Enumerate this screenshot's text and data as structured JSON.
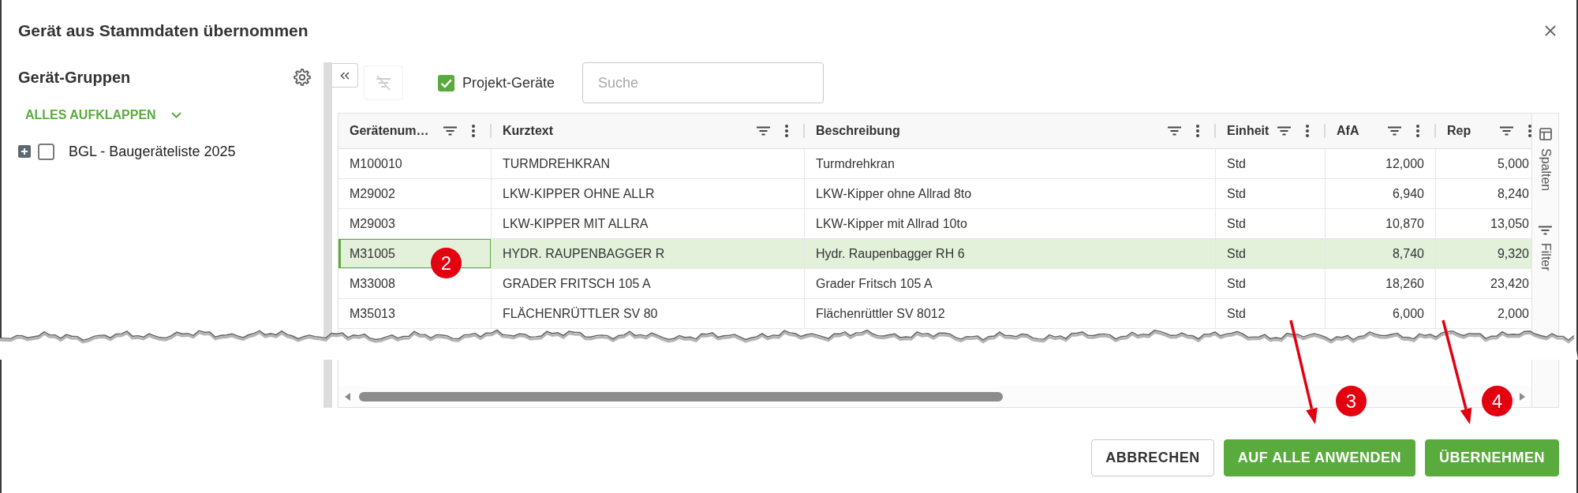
{
  "dialog": {
    "title": "Gerät aus Stammdaten übernommen"
  },
  "sidebar": {
    "title": "Gerät-Gruppen",
    "expand_all": "ALLES AUFKLAPPEN",
    "tree": [
      {
        "label": "BGL - Baugeräteliste 2025",
        "expanded": false,
        "checked": false
      }
    ]
  },
  "toolbar": {
    "clear_filter": {
      "disabled": true
    },
    "project_filter": {
      "label": "Projekt-Geräte",
      "checked": true
    },
    "search": {
      "placeholder": "Suche"
    }
  },
  "table": {
    "columns": [
      {
        "label": "Gerätenum…",
        "kind": "text"
      },
      {
        "label": "Kurztext",
        "kind": "text"
      },
      {
        "label": "Beschreibung",
        "kind": "text"
      },
      {
        "label": "Einheit",
        "kind": "text"
      },
      {
        "label": "AfA",
        "kind": "number"
      },
      {
        "label": "Rep",
        "kind": "number"
      }
    ],
    "rows": [
      {
        "cells": [
          "M100010",
          "TURMDREHKRAN",
          "Turmdrehkran",
          "Std",
          "12,000",
          "5,000"
        ],
        "selected": false
      },
      {
        "cells": [
          "M29002",
          "LKW-KIPPER OHNE ALLR",
          "LKW-Kipper ohne Allrad 8to",
          "Std",
          "6,940",
          "8,240"
        ],
        "selected": false
      },
      {
        "cells": [
          "M29003",
          "LKW-KIPPER MIT ALLRA",
          "LKW-Kipper mit Allrad 10to",
          "Std",
          "10,870",
          "13,050"
        ],
        "selected": false
      },
      {
        "cells": [
          "M31005",
          "HYDR. RAUPENBAGGER R",
          "Hydr. Raupenbagger RH 6",
          "Std",
          "8,740",
          "9,320"
        ],
        "selected": true,
        "annotation": {
          "label": "2"
        }
      },
      {
        "cells": [
          "M33008",
          "GRADER FRITSCH 105 A",
          "Grader Fritsch 105 A",
          "Std",
          "18,260",
          "23,420"
        ],
        "selected": false
      },
      {
        "cells": [
          "M35013",
          "FLÄCHENRÜTTLER SV 80",
          "Flächenrüttler SV 8012",
          "Std",
          "6,000",
          "2,000"
        ],
        "selected": false
      }
    ]
  },
  "side_panel": [
    {
      "kind": "columns",
      "label": "Spalten"
    },
    {
      "kind": "filter",
      "label": "Filter"
    }
  ],
  "buttons": [
    {
      "label": "ABBRECHEN",
      "kind": "secondary"
    },
    {
      "label": "AUF ALLE ANWENDEN",
      "kind": "primary",
      "annotation": {
        "label": "3",
        "arrow": true
      }
    },
    {
      "label": "ÜBERNEHMEN",
      "kind": "primary",
      "annotation": {
        "label": "4",
        "arrow": true
      }
    }
  ],
  "torn_edge": true
}
